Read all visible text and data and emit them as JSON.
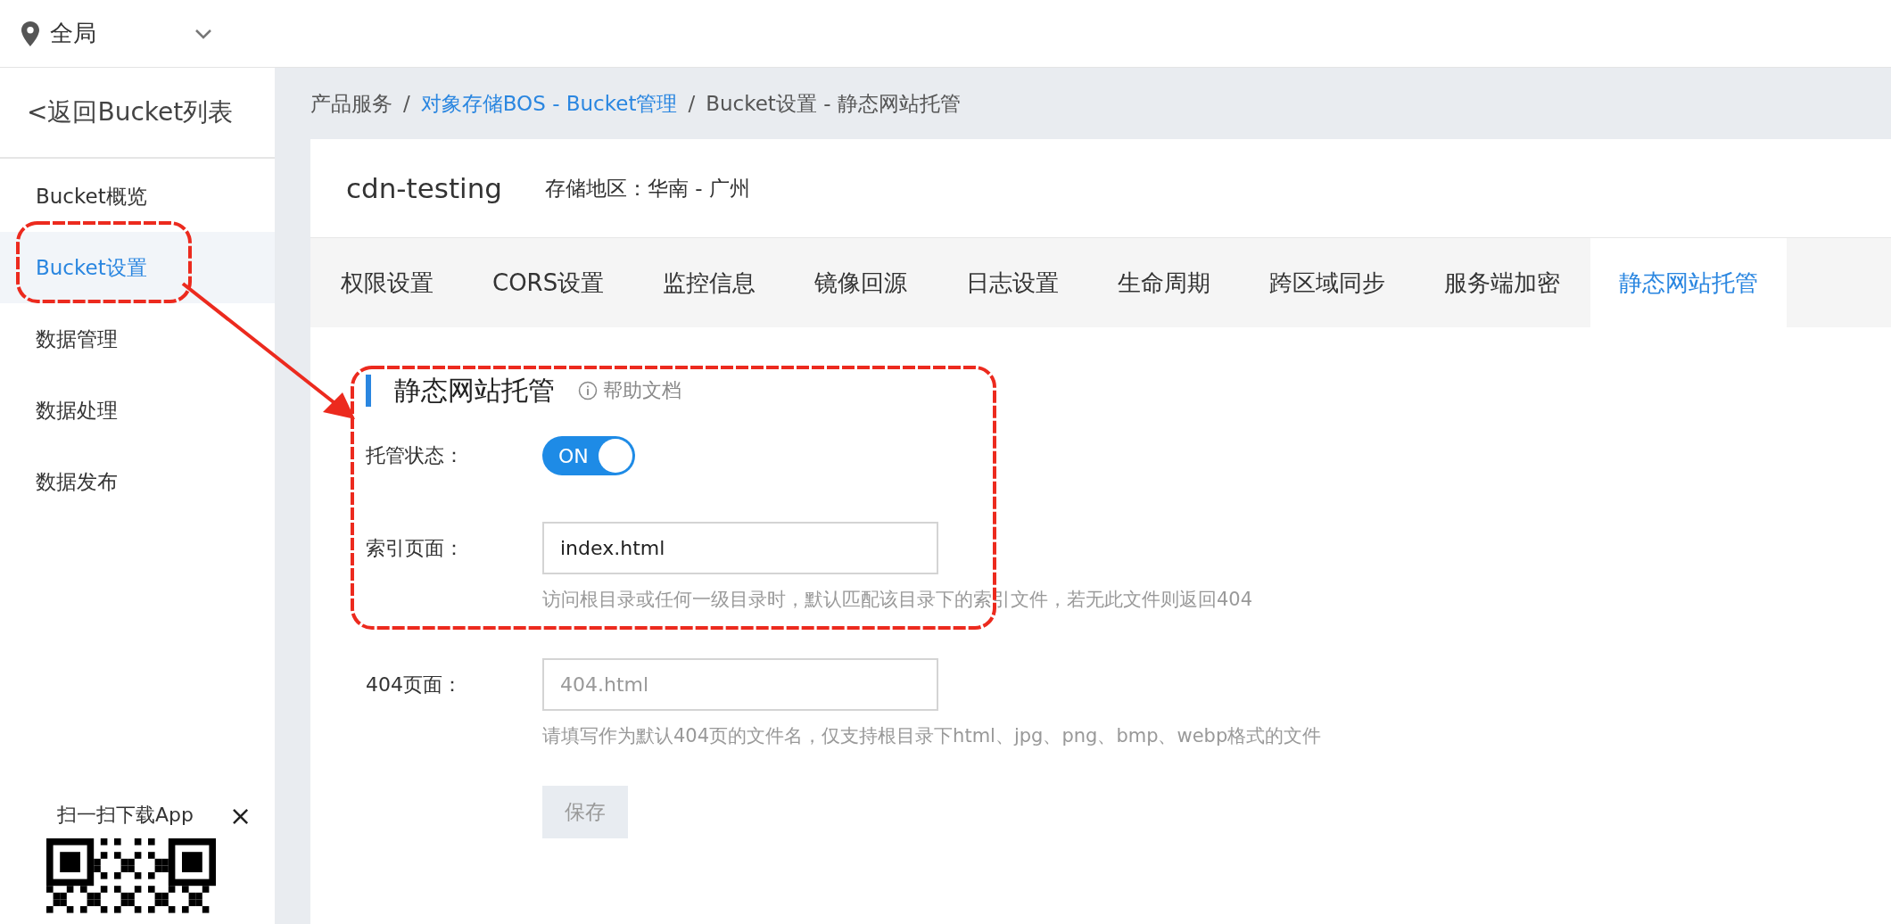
{
  "top_bar": {
    "scope": "全局"
  },
  "sidebar": {
    "back_link": "<返回Bucket列表",
    "items": [
      {
        "label": "Bucket概览",
        "selected": false
      },
      {
        "label": "Bucket设置",
        "selected": true
      },
      {
        "label": "数据管理",
        "selected": false
      },
      {
        "label": "数据处理",
        "selected": false
      },
      {
        "label": "数据发布",
        "selected": false
      }
    ],
    "app_promo": {
      "label": "扫一扫下载App",
      "close": "×"
    }
  },
  "breadcrumb": [
    {
      "kind": "text",
      "label": "产品服务"
    },
    {
      "kind": "separator",
      "label": "/"
    },
    {
      "kind": "link",
      "label": "对象存储BOS - Bucket管理"
    },
    {
      "kind": "separator",
      "label": "/"
    },
    {
      "kind": "text",
      "label": "Bucket设置 - 静态网站托管"
    }
  ],
  "bucket": {
    "name": "cdn-testing",
    "region": "存储地区：华南 - 广州"
  },
  "tabs": [
    {
      "label": "权限设置",
      "selected": false
    },
    {
      "label": "CORS设置",
      "selected": false
    },
    {
      "label": "监控信息",
      "selected": false
    },
    {
      "label": "镜像回源",
      "selected": false
    },
    {
      "label": "日志设置",
      "selected": false
    },
    {
      "label": "生命周期",
      "selected": false
    },
    {
      "label": "跨区域同步",
      "selected": false
    },
    {
      "label": "服务端加密",
      "selected": false
    },
    {
      "label": "静态网站托管",
      "selected": true
    }
  ],
  "section": {
    "title": "静态网站托管",
    "help_link": "帮助文档"
  },
  "form": {
    "rows": [
      {
        "kind": "toggle",
        "label": "托管状态：",
        "on": true,
        "text": "ON"
      },
      {
        "kind": "input",
        "label": "索引页面：",
        "value": "index.html",
        "hint": "访问根目录或任何一级目录时，默认匹配该目录下的索引文件，若无此文件则返回404"
      },
      {
        "kind": "input",
        "label": "404页面：",
        "placeholder": "404.html",
        "hint": "请填写作为默认404页的文件名，仅支持根目录下html、jpg、png、bmp、webp格式的文件"
      }
    ],
    "save_button": {
      "label": "保存",
      "disabled": true
    }
  },
  "annotations": [
    {
      "kind": "outline"
    },
    {
      "kind": "arrow"
    },
    {
      "kind": "outline"
    }
  ]
}
